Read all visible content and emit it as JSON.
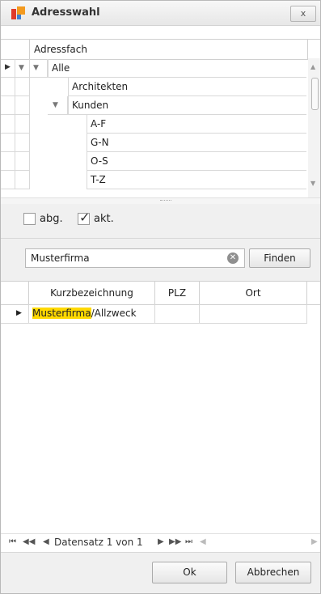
{
  "window": {
    "title": "Adresswahl",
    "close_label": "x"
  },
  "tree": {
    "column_header": "Adressfach",
    "rows": [
      {
        "label": "Alle"
      },
      {
        "label": "Architekten"
      },
      {
        "label": "Kunden"
      },
      {
        "label": "A-F"
      },
      {
        "label": "G-N"
      },
      {
        "label": "O-S"
      },
      {
        "label": "T-Z"
      }
    ]
  },
  "filters": {
    "abg_label": "abg.",
    "akt_label": "akt.",
    "abg_checked": false,
    "akt_checked": true
  },
  "search": {
    "value": "Musterfirma",
    "find_label": "Finden"
  },
  "results": {
    "columns": [
      "Kurzbezeichnung",
      "PLZ",
      "Ort"
    ],
    "rows": [
      {
        "match": "Musterfirma",
        "rest": "/Allzweck",
        "plz": "",
        "ort": ""
      }
    ]
  },
  "navigator": {
    "record_text": "Datensatz 1 von 1"
  },
  "buttons": {
    "ok": "Ok",
    "cancel": "Abbrechen"
  },
  "colors": {
    "highlight": "#ffd900",
    "panel": "#f0f0f0"
  }
}
